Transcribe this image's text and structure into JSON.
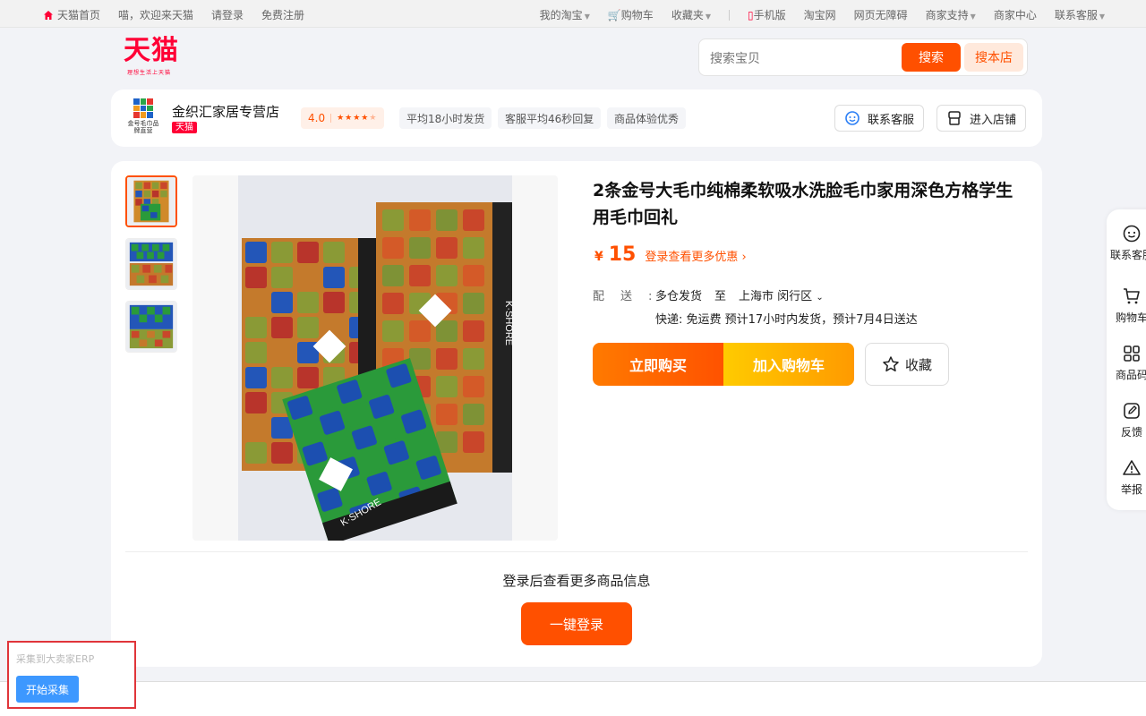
{
  "topbar": {
    "home": "天猫首页",
    "welcome": "喵，欢迎来天猫",
    "login": "请登录",
    "register": "免费注册",
    "my_taobao": "我的淘宝",
    "cart": "购物车",
    "favorites": "收藏夹",
    "mobile": "手机版",
    "taobao": "淘宝网",
    "accessible": "网页无障碍",
    "merchant_support": "商家支持",
    "merchant_center": "商家中心",
    "contact": "联系客服"
  },
  "header": {
    "logo": "天猫",
    "logo_slogan": "理想生活上天猫",
    "search_placeholder": "搜索宝贝",
    "search_button": "搜索",
    "search_store_button": "搜本店"
  },
  "shop": {
    "logo_text": "金号毛巾品牌直营",
    "name": "金织汇家居专营店",
    "badge": "天猫",
    "rating": "4.0",
    "tags": [
      "平均18小时发货",
      "客服平均46秒回复",
      "商品体验优秀"
    ],
    "contact_button": "联系客服",
    "enter_button": "进入店铺"
  },
  "product": {
    "title": "2条金号大毛巾纯棉柔软吸水洗脸毛巾家用深色方格学生用毛巾回礼",
    "currency": "¥",
    "price": "15",
    "promo": "登录查看更多优惠",
    "ship_label": "配送:",
    "ship_from": "多仓发货",
    "ship_to_word": "至",
    "ship_to": "上海市 闵行区",
    "ship_detail": "快递: 免运费  预计17小时内发货，预计7月4日送达",
    "buy_button": "立即购买",
    "cart_button": "加入购物车",
    "fav_button": "收藏",
    "tag_text": "K·SHORE"
  },
  "login_prompt": {
    "tip": "登录后查看更多商品信息",
    "button": "一键登录"
  },
  "float": {
    "items": [
      "联系客服",
      "购物车",
      "商品码",
      "反馈",
      "举报"
    ]
  },
  "erp": {
    "label": "采集到大卖家ERP",
    "button": "开始采集"
  },
  "colors": {
    "brand": "#ff0036",
    "accent": "#ff5000",
    "erp_blue": "#3d98ff"
  }
}
